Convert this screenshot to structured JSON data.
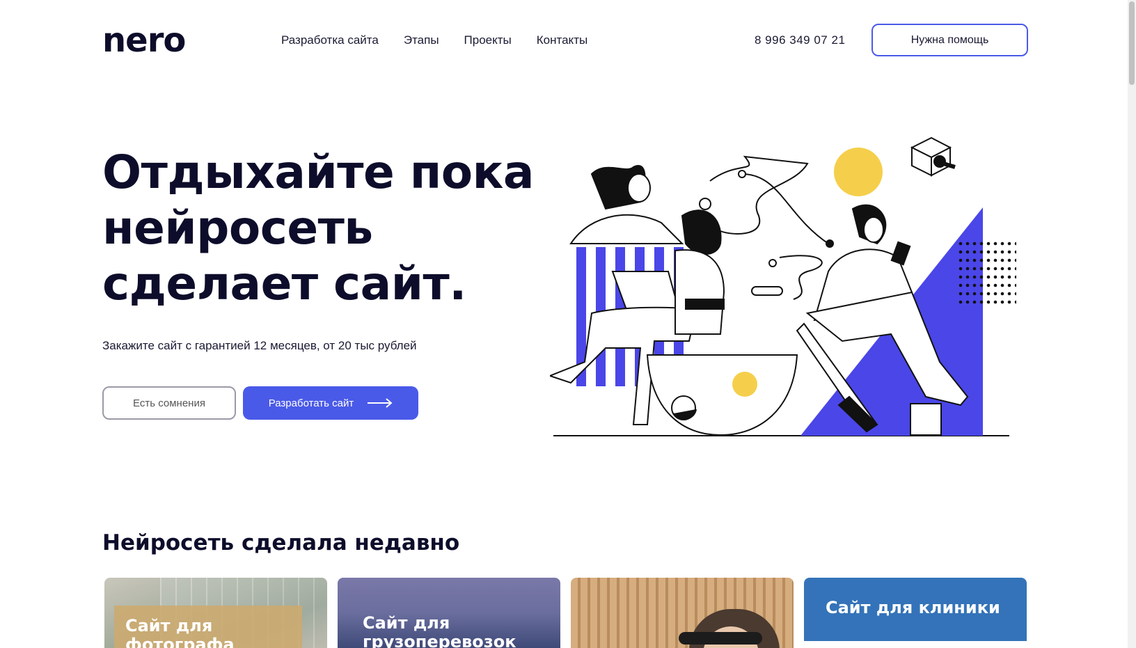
{
  "header": {
    "logo": "nero",
    "nav": [
      "Разработка сайта",
      "Этапы",
      "Проекты",
      "Контакты"
    ],
    "phone": "8 996 349 07 21",
    "help_button": "Нужна помощь"
  },
  "hero": {
    "title_lines": [
      "Отдыхайте пока",
      "нейросеть",
      "сделает сайт."
    ],
    "subtitle": "Закажите сайт с гарантией 12 месяцев, от 20 тыс рублей",
    "doubt_button": "Есть сомнения",
    "develop_button": "Разработать сайт"
  },
  "recent": {
    "title": "Нейросеть сделала недавно",
    "cards": [
      {
        "label": "Сайт для фотографа"
      },
      {
        "label": "Сайт для грузоперевозок"
      },
      {
        "label": ""
      },
      {
        "label": "Сайт для клиники"
      }
    ]
  },
  "colors": {
    "accent": "#4a5ae8",
    "dark_text": "#0d0d2b",
    "yellow": "#f5cf4b",
    "clinic_blue": "#3473b9"
  }
}
